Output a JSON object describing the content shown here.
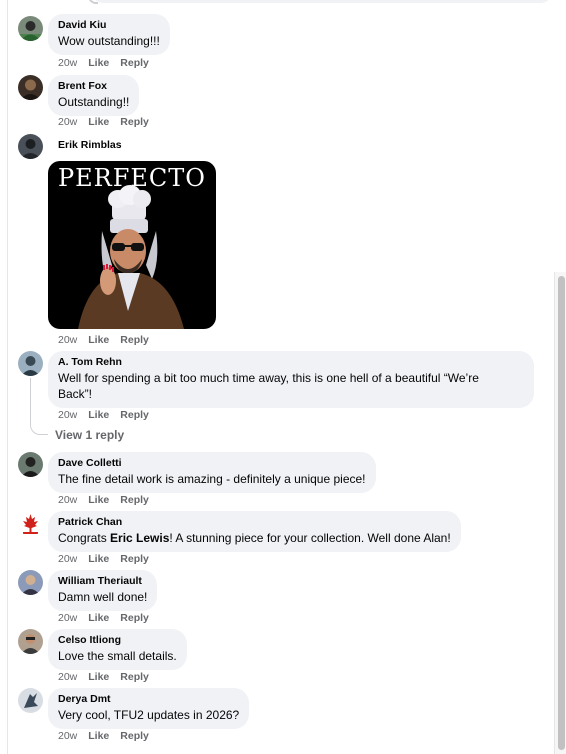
{
  "comments": [
    {
      "name": "David Kiu",
      "text": "Wow outstanding!!!",
      "time": "20w",
      "like": "Like",
      "reply": "Reply",
      "avatar_color": "#3a4a3a"
    },
    {
      "name": "Brent Fox",
      "text": "Outstanding!!",
      "time": "20w",
      "like": "Like",
      "reply": "Reply",
      "avatar_color": "#4a3a2a"
    },
    {
      "name": "Erik Rimblas",
      "sticker_text": "PERFECTO",
      "time": "20w",
      "like": "Like",
      "reply": "Reply",
      "avatar_color": "#2a2e33"
    },
    {
      "name": "A. Tom Rehn",
      "text_line1": "Well for spending a bit too much time away, this is one hell of a beautiful “We’re",
      "text_line2": "Back”!",
      "time": "20w",
      "like": "Like",
      "reply": "Reply",
      "avatar_color": "#5a7a8a",
      "view_replies": "View 1 reply"
    },
    {
      "name": "Dave Colletti",
      "text": "The fine detail work is amazing - definitely a unique piece!",
      "time": "20w",
      "like": "Like",
      "reply": "Reply",
      "avatar_color": "#3c4a40"
    },
    {
      "name": "Patrick Chan",
      "text_pre": "Congrats ",
      "mention": "Eric Lewis",
      "text_post": "! A stunning piece for your collection. Well done Alan!",
      "time": "20w",
      "like": "Like",
      "reply": "Reply",
      "avatar_color": "#d0221b"
    },
    {
      "name": "William Theriault",
      "text": "Damn well done!",
      "time": "20w",
      "like": "Like",
      "reply": "Reply",
      "avatar_color": "#6a7a9a"
    },
    {
      "name": "Celso Itliong",
      "text": "Love the small details.",
      "time": "20w",
      "like": "Like",
      "reply": "Reply",
      "avatar_color": "#5a4a3a"
    },
    {
      "name": "Derya Dmt",
      "text": "Very cool, TFU2 updates in 2026?",
      "time": "20w",
      "like": "Like",
      "reply": "Reply",
      "avatar_color": "#8a9aaa"
    }
  ],
  "icons": {
    "avatar": "avatar-icon",
    "sticker": "chef-sticker-image"
  }
}
